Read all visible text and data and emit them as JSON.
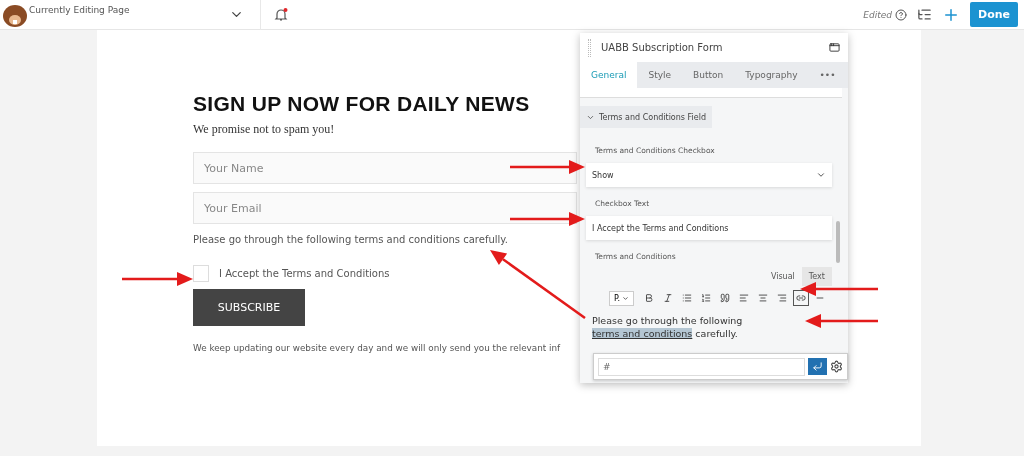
{
  "top_bar": {
    "page_title": "Currently Editing Page",
    "notifications_unread": true,
    "status": "Edited",
    "done_button": "Done"
  },
  "form": {
    "heading": "SIGN UP NOW FOR DAILY NEWS",
    "subheading": "We promise not to spam you!",
    "fields": [
      {
        "placeholder": "Your Name"
      },
      {
        "placeholder": "Your Email"
      }
    ],
    "terms_text": "Please go through the following terms and conditions carefully.",
    "checkbox": {
      "label": "I Accept the Terms and Conditions",
      "checked": false
    },
    "submit_button": "SUBSCRIBE",
    "footer_text": "We keep updating our website every day and we will only send you the relevant inf"
  },
  "panel": {
    "title": "UABB Subscription Form",
    "tabs": [
      {
        "label": "General",
        "selected": true
      },
      {
        "label": "Style",
        "selected": false
      },
      {
        "label": "Button",
        "selected": false
      },
      {
        "label": "Typography",
        "selected": false
      },
      {
        "label": "•••",
        "selected": false
      }
    ],
    "section": {
      "title": "Terms and Conditions Field",
      "expanded": true
    },
    "checkbox_setting": {
      "label": "Terms and Conditions Checkbox",
      "value": "Show"
    },
    "text_setting": {
      "label": "Checkbox Text",
      "value": "I Accept the Terms and Conditions"
    },
    "editor": {
      "label": "Terms and Conditions",
      "modes": [
        {
          "label": "Visual",
          "selected": true
        },
        {
          "label": "Text",
          "selected": false
        }
      ],
      "format": "P.",
      "tools": [
        {
          "kind": "bold",
          "active": false
        },
        {
          "kind": "italic",
          "active": false
        },
        {
          "kind": "bullets",
          "active": false
        },
        {
          "kind": "numbers",
          "active": false
        },
        {
          "kind": "quote",
          "active": false
        },
        {
          "kind": "left",
          "active": false
        },
        {
          "kind": "center",
          "active": false
        },
        {
          "kind": "right",
          "active": false
        },
        {
          "kind": "link",
          "active": true
        },
        {
          "kind": "more",
          "active": false
        }
      ],
      "text_before": "Please go through the following ",
      "link_text": "terms and conditions",
      "text_after": " carefully.",
      "link_url": "#"
    }
  }
}
